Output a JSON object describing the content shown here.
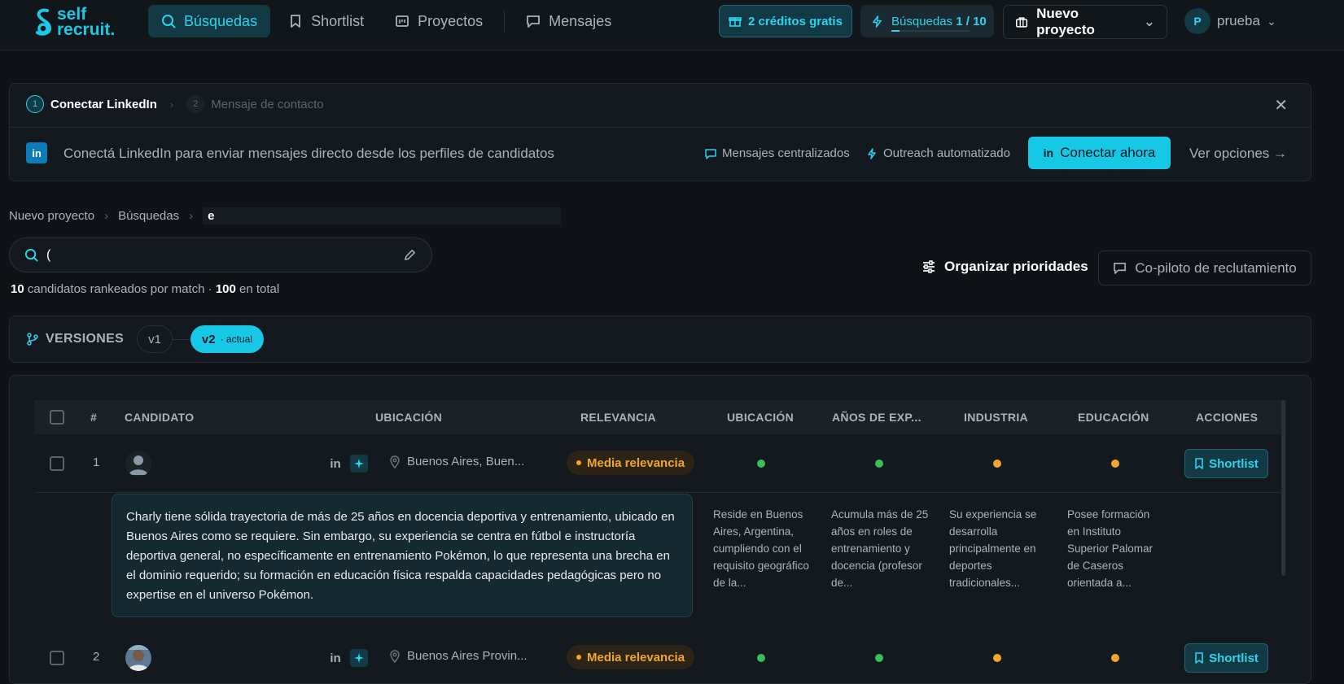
{
  "brand": {
    "name_line1": "self",
    "name_line2": "recruit."
  },
  "nav": {
    "items": [
      {
        "label": "Búsquedas",
        "icon": "search-icon"
      },
      {
        "label": "Shortlist",
        "icon": "bookmark-icon"
      },
      {
        "label": "Proyectos",
        "icon": "folder-icon"
      },
      {
        "label": "Mensajes",
        "icon": "chat-icon"
      }
    ]
  },
  "header": {
    "credits_label": "2 créditos gratis",
    "searches_label": "Búsquedas",
    "searches_value": "1 / 10",
    "searches_progress": 0.1,
    "project_label": "Nuevo proyecto",
    "user_initial": "P",
    "user_name": "prueba"
  },
  "linkedin_card": {
    "step1_num": "1",
    "step1_label": "Conectar LinkedIn",
    "step2_num": "2",
    "step2_label": "Mensaje de contacto",
    "logo_text": "in",
    "text": "Conectá LinkedIn para enviar mensajes directo desde los perfiles de candidatos",
    "feature1": "Mensajes centralizados",
    "feature2": "Outreach automatizado",
    "connect_label": "Conectar ahora",
    "options_label": "Ver opciones"
  },
  "breadcrumb": [
    "Nuevo proyecto",
    "Búsquedas",
    "e"
  ],
  "search": {
    "value": "("
  },
  "count": {
    "ranked": "10",
    "ranked_text": "candidatos rankeados por match ·",
    "total": "100",
    "total_text": "en total"
  },
  "actions": {
    "prioritize": "Organizar prioridades",
    "copilot": "Co-piloto de reclutamiento"
  },
  "versions": {
    "title": "VERSIONES",
    "v1": "v1",
    "v2": "v2",
    "v2_tag": "· actual"
  },
  "table": {
    "headers": {
      "num": "#",
      "candidate": "CANDIDATO",
      "location": "UBICACIÓN",
      "relevance": "RELEVANCIA",
      "c_location": "UBICACIÓN",
      "c_years": "AÑOS DE EXP...",
      "c_industry": "INDUSTRIA",
      "c_education": "EDUCACIÓN",
      "actions": "ACCIONES"
    },
    "rows": [
      {
        "num": "1",
        "location": "Buenos Aires, Buen...",
        "relevance": "Media relevancia",
        "criteria": [
          "green",
          "green",
          "orange",
          "orange"
        ],
        "shortlist": "Shortlist",
        "summary": "Charly tiene sólida trayectoria de más de 25 años en docencia deportiva y entrenamiento, ubicado en Buenos Aires como se requiere. Sin embargo, su experiencia se centra en fútbol e instructoría deportiva general, no específicamente en entrenamiento Pokémon, lo que representa una brecha en el dominio requerido; su formación en educación física respalda capacidades pedagógicas pero no expertise en el universo Pokémon.",
        "details": [
          "Reside en Buenos Aires, Argentina, cumpliendo con el requisito geográfico de la...",
          "Acumula más de 25 años en roles de entrenamiento y docencia (profesor de...",
          "Su experiencia se desarrolla principalmente en deportes tradicionales...",
          "Posee formación en Instituto Superior Palomar de Caseros orientada a..."
        ]
      },
      {
        "num": "2",
        "location": "Buenos Aires Provin...",
        "relevance": "Media relevancia",
        "criteria": [
          "green",
          "green",
          "orange",
          "orange"
        ],
        "shortlist": "Shortlist"
      }
    ]
  },
  "colors": {
    "accent": "#16c8e6",
    "background": "#0f1318",
    "warning": "#f2a72c",
    "success": "#3bbd5b"
  }
}
